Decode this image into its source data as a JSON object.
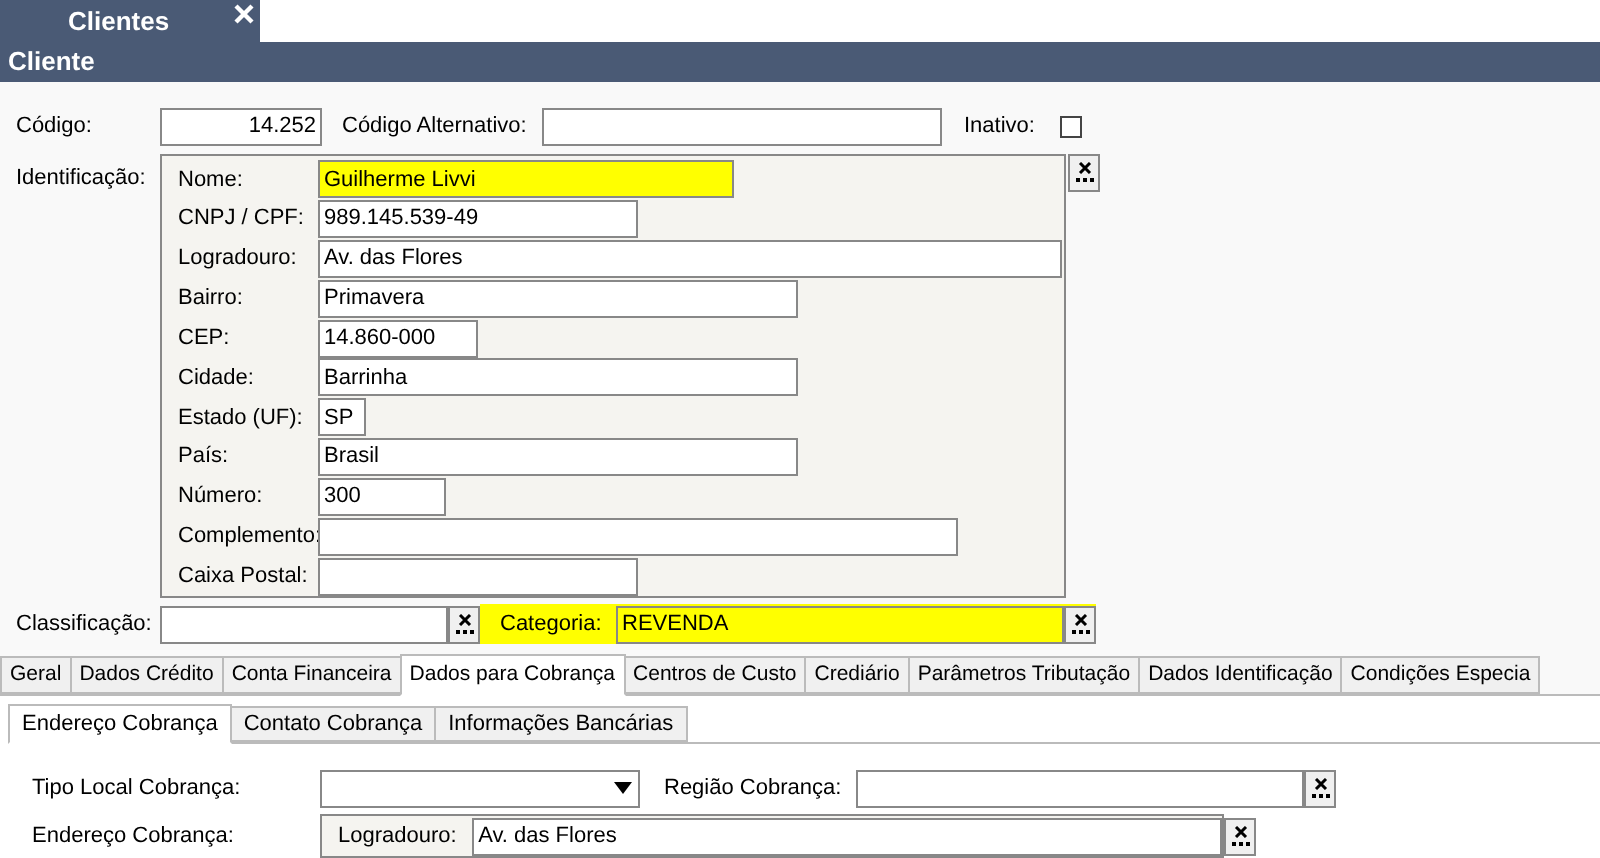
{
  "doc_tab": {
    "label": "Clientes"
  },
  "title": "Cliente",
  "codigo": {
    "label": "Código:",
    "value": "14.252"
  },
  "codigo_alternativo": {
    "label": "Código Alternativo:"
  },
  "inativo": {
    "label": "Inativo:",
    "checked": false
  },
  "identificacao": {
    "label": "Identificação:",
    "fields": [
      {
        "label": "Nome:",
        "value": "Guilherme Livvi",
        "highlighted": true
      },
      {
        "label": "CNPJ / CPF:",
        "value": "989.145.539-49",
        "highlighted": false
      },
      {
        "label": "Logradouro:",
        "value": "Av. das Flores",
        "highlighted": false
      },
      {
        "label": "Bairro:",
        "value": "Primavera",
        "highlighted": false
      },
      {
        "label": "CEP:",
        "value": "14.860-000",
        "highlighted": false
      },
      {
        "label": "Cidade:",
        "value": "Barrinha",
        "highlighted": false
      },
      {
        "label": "Estado (UF):",
        "value": "SP",
        "highlighted": false
      },
      {
        "label": "País:",
        "value": "Brasil",
        "highlighted": false
      },
      {
        "label": "Número:",
        "value": "300",
        "highlighted": false
      },
      {
        "label": "Complemento:",
        "highlighted": false
      },
      {
        "label": "Caixa Postal:",
        "highlighted": false
      }
    ]
  },
  "classificacao": {
    "label": "Classificação:"
  },
  "categoria": {
    "label": "Categoria:",
    "value": "REVENDA",
    "highlighted": true
  },
  "tabs": [
    {
      "label": "Geral",
      "selected": false
    },
    {
      "label": "Dados Crédito",
      "selected": false
    },
    {
      "label": "Conta Financeira",
      "selected": false
    },
    {
      "label": "Dados para Cobrança",
      "selected": true
    },
    {
      "label": "Centros de Custo",
      "selected": false
    },
    {
      "label": "Crediário",
      "selected": false
    },
    {
      "label": "Parâmetros Tributação",
      "selected": false
    },
    {
      "label": "Dados Identificação",
      "selected": false
    },
    {
      "label": "Condições Especia",
      "selected": false
    }
  ],
  "subtabs": [
    {
      "label": "Endereço Cobrança",
      "selected": true
    },
    {
      "label": "Contato Cobrança",
      "selected": false
    },
    {
      "label": "Informações Bancárias",
      "selected": false
    }
  ],
  "tipo_local_cobranca": {
    "label": "Tipo Local Cobrança:"
  },
  "regiao_cobranca": {
    "label": "Região Cobrança:"
  },
  "endereco_cobranca": {
    "label": "Endereço Cobrança:",
    "field_label": "Logradouro:",
    "value": "Av. das Flores"
  }
}
